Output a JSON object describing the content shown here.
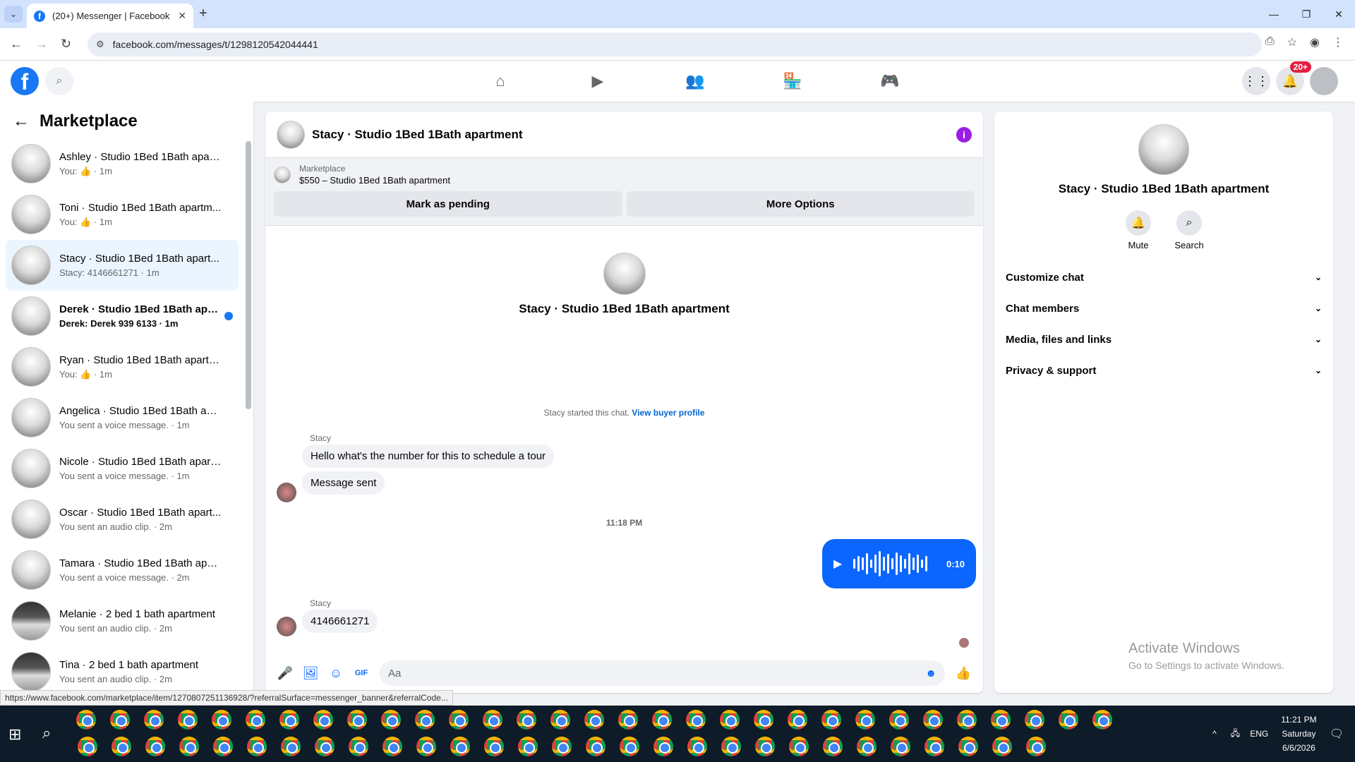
{
  "browser": {
    "tab_title": "(20+) Messenger | Facebook",
    "url": "facebook.com/messages/t/1298120542044441",
    "status_url": "https://www.facebook.com/marketplace/item/1270807251136928/?referralSurface=messenger_banner&referralCode..."
  },
  "header": {
    "notification_badge": "20+"
  },
  "sidebar": {
    "title": "Marketplace",
    "items": [
      {
        "title": "Ashley · Studio 1Bed 1Bath apart...",
        "sub": "You: 👍 · 1m"
      },
      {
        "title": "Toni · Studio 1Bed 1Bath apartm...",
        "sub": "You: 👍 · 1m"
      },
      {
        "title": "Stacy · Studio 1Bed 1Bath apart...",
        "sub": "Stacy: 4146661271 · 1m"
      },
      {
        "title": "Derek · Studio 1Bed 1Bath apar...",
        "sub": "Derek: Derek 939 6133 · 1m"
      },
      {
        "title": "Ryan · Studio 1Bed 1Bath apartm...",
        "sub": "You: 👍 · 1m"
      },
      {
        "title": "Angelica · Studio 1Bed 1Bath apa...",
        "sub": "You sent a voice message. · 1m"
      },
      {
        "title": "Nicole · Studio 1Bed 1Bath apart...",
        "sub": "You sent a voice message. · 1m"
      },
      {
        "title": "Oscar · Studio 1Bed 1Bath apart...",
        "sub": "You sent an audio clip. · 2m"
      },
      {
        "title": "Tamara · Studio 1Bed 1Bath apar...",
        "sub": "You sent a voice message. · 2m"
      },
      {
        "title": "Melanie · 2 bed 1 bath apartment",
        "sub": "You sent an audio clip. · 2m"
      },
      {
        "title": "Tina · 2 bed 1 bath apartment",
        "sub": "You sent an audio clip. · 2m"
      }
    ]
  },
  "chat": {
    "title": "Stacy · Studio 1Bed 1Bath apartment",
    "banner_label": "Marketplace",
    "banner_price": "$550 – Studio 1Bed 1Bath apartment",
    "btn_pending": "Mark as pending",
    "btn_more": "More Options",
    "intro_name": "Stacy · Studio 1Bed 1Bath apartment",
    "started_text": "Stacy started this chat.",
    "buyer_link": "View buyer profile",
    "sender1": "Stacy",
    "msg1": "Hello what's the number for this to schedule a tour",
    "msg2": "Message sent",
    "time": "11:18 PM",
    "voice_duration": "0:10",
    "sender2": "Stacy",
    "msg3": "4146661271",
    "placeholder": "Aa"
  },
  "details": {
    "name": "Stacy · Studio 1Bed 1Bath apartment",
    "mute": "Mute",
    "search": "Search",
    "rows": [
      "Customize chat",
      "Chat members",
      "Media, files and links",
      "Privacy & support"
    ]
  },
  "watermark": {
    "line1": "Activate Windows",
    "line2": "Go to Settings to activate Windows."
  },
  "taskbar": {
    "lang": "ENG",
    "time": "11:21 PM",
    "day": "Saturday",
    "date": "6/6/2026"
  }
}
